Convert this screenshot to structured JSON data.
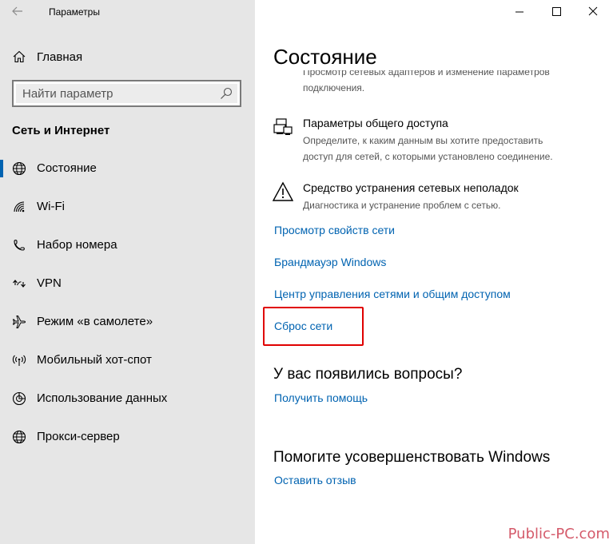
{
  "window": {
    "app_title": "Параметры"
  },
  "sidebar": {
    "home_label": "Главная",
    "search_placeholder": "Найти параметр",
    "section_title": "Сеть и Интернет",
    "items": [
      {
        "label": "Состояние",
        "icon": "globe-icon",
        "active": true
      },
      {
        "label": "Wi-Fi",
        "icon": "wifi-icon"
      },
      {
        "label": "Набор номера",
        "icon": "dialup-icon"
      },
      {
        "label": "VPN",
        "icon": "vpn-icon"
      },
      {
        "label": "Режим «в самолете»",
        "icon": "airplane-icon"
      },
      {
        "label": "Мобильный хот-спот",
        "icon": "hotspot-icon"
      },
      {
        "label": "Использование данных",
        "icon": "data-usage-icon"
      },
      {
        "label": "Прокси-сервер",
        "icon": "globe-icon"
      }
    ]
  },
  "main": {
    "title": "Состояние",
    "partial_text_line1": "Просмотр сетевых адаптеров и изменение параметров",
    "partial_text_line2": "подключения.",
    "sharing": {
      "title": "Параметры общего доступа",
      "desc_line1": "Определите, к каким данным вы хотите предоставить",
      "desc_line2": "доступ для сетей, с которыми установлено соединение."
    },
    "troubleshoot": {
      "title": "Средство устранения сетевых неполадок",
      "desc": "Диагностика и устранение проблем с сетью."
    },
    "links": {
      "properties": "Просмотр свойств сети",
      "firewall": "Брандмауэр Windows",
      "center": "Центр управления сетями и общим доступом",
      "reset": "Сброс сети"
    },
    "questions": {
      "heading": "У вас появились вопросы?",
      "link": "Получить помощь"
    },
    "improve": {
      "heading": "Помогите усовершенствовать Windows",
      "link": "Оставить отзыв"
    }
  },
  "watermark": "Public-PC.com",
  "colors": {
    "accent": "#0063b1",
    "highlight": "#e00000",
    "sidebar_bg": "#e6e6e6"
  }
}
